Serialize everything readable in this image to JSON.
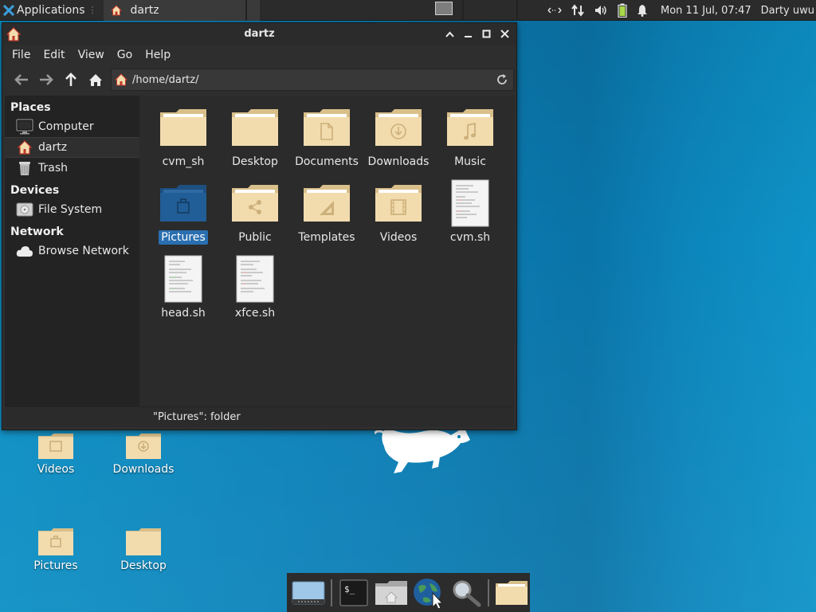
{
  "top_panel": {
    "applications_label": "Applications",
    "task_title": "dartz",
    "clock": "Mon 11 Jul, 07:47",
    "user": "Darty uwu"
  },
  "window": {
    "title": "dartz",
    "menu": [
      "File",
      "Edit",
      "View",
      "Go",
      "Help"
    ],
    "path": "/home/dartz/",
    "status": "\"Pictures\": folder"
  },
  "sidebar": {
    "places_header": "Places",
    "places": [
      {
        "label": "Computer",
        "icon": "computer-icon"
      },
      {
        "label": "dartz",
        "icon": "home-folder-icon"
      },
      {
        "label": "Trash",
        "icon": "trash-icon"
      }
    ],
    "devices_header": "Devices",
    "devices": [
      {
        "label": "File System",
        "icon": "drive-icon"
      }
    ],
    "network_header": "Network",
    "network": [
      {
        "label": "Browse Network",
        "icon": "cloud-icon"
      }
    ]
  },
  "files": [
    {
      "label": "cvm_sh",
      "kind": "folder",
      "emblem": "none"
    },
    {
      "label": "Desktop",
      "kind": "folder",
      "emblem": "none"
    },
    {
      "label": "Documents",
      "kind": "folder",
      "emblem": "document"
    },
    {
      "label": "Downloads",
      "kind": "folder",
      "emblem": "download"
    },
    {
      "label": "Music",
      "kind": "folder",
      "emblem": "music"
    },
    {
      "label": "Pictures",
      "kind": "folder-selected",
      "emblem": "picture"
    },
    {
      "label": "Public",
      "kind": "folder",
      "emblem": "share"
    },
    {
      "label": "Templates",
      "kind": "folder",
      "emblem": "template"
    },
    {
      "label": "Videos",
      "kind": "folder",
      "emblem": "video"
    },
    {
      "label": "cvm.sh",
      "kind": "script",
      "emblem": "none"
    },
    {
      "label": "head.sh",
      "kind": "script",
      "emblem": "none"
    },
    {
      "label": "xfce.sh",
      "kind": "script",
      "emblem": "none"
    }
  ],
  "desktop_icons": {
    "videos": "Videos",
    "downloads": "Downloads",
    "pictures": "Pictures",
    "desktop": "Desktop"
  },
  "colors": {
    "folder": "#f2dcae",
    "folder_dark": "#d9bf8a",
    "selection": "#2a6fb0",
    "desktop_blue": "#0c80b7"
  }
}
